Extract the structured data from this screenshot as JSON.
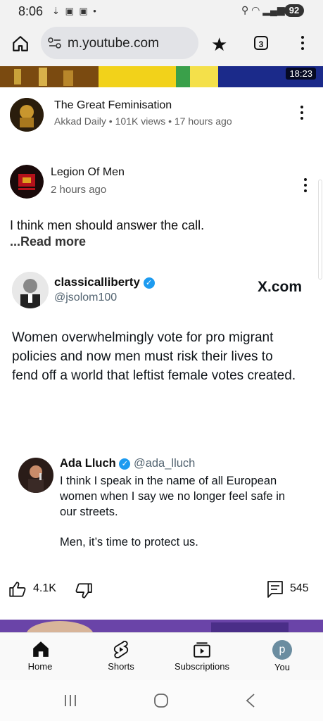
{
  "status_bar": {
    "time": "8:06",
    "battery": "92"
  },
  "browser": {
    "url": "m.youtube.com",
    "tab_count": "3"
  },
  "video": {
    "duration": "18:23",
    "title": "The Great Feminisation",
    "channel": "Akkad Daily",
    "views": "101K views",
    "age": "17 hours ago"
  },
  "post": {
    "channel": "Legion Of Men",
    "age": "2 hours ago",
    "text": "I think men should answer the call.",
    "read_more": "...Read more",
    "likes": "4.1K",
    "comments": "545"
  },
  "tweet": {
    "display_name": "classicalliberty",
    "handle": "@jsolom100",
    "source": "X.com",
    "text": "Women overwhelmingly vote for pro migrant policies and now men must risk their lives to fend off a world that leftist female votes created."
  },
  "quoted_tweet": {
    "display_name": "Ada Lluch",
    "handle": "@ada_lluch",
    "text_1": "I think I speak in the name of all European women when I say we no longer feel safe in our streets.",
    "text_2": "Men, it’s time to protect us."
  },
  "bottom_nav": {
    "home": "Home",
    "shorts": "Shorts",
    "subscriptions": "Subscriptions",
    "you": "You",
    "you_avatar_letter": "p"
  },
  "colors": {
    "verified": "#1d9bf0",
    "meta_gray": "#606060"
  }
}
